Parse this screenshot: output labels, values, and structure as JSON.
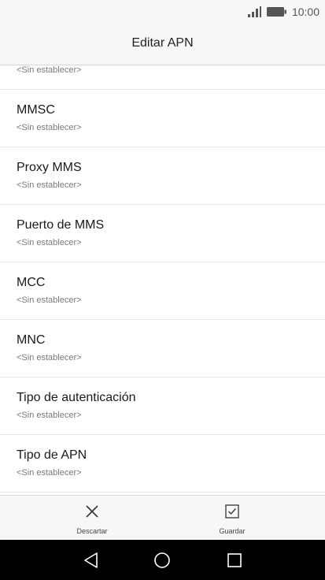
{
  "status_bar": {
    "time": "10:00",
    "icons": [
      "signal-icon",
      "battery-icon"
    ]
  },
  "header": {
    "title": "Editar APN"
  },
  "list": {
    "items": [
      {
        "title": "",
        "value": "<Sin establecer>"
      },
      {
        "title": "MMSC",
        "value": "<Sin establecer>"
      },
      {
        "title": "Proxy MMS",
        "value": "<Sin establecer>"
      },
      {
        "title": "Puerto de MMS",
        "value": "<Sin establecer>"
      },
      {
        "title": "MCC",
        "value": "<Sin establecer>"
      },
      {
        "title": "MNC",
        "value": "<Sin establecer>"
      },
      {
        "title": "Tipo de autenticación",
        "value": "<Sin establecer>"
      },
      {
        "title": "Tipo de APN",
        "value": "<Sin establecer>"
      }
    ]
  },
  "bottom_bar": {
    "discard_label": "Descartar",
    "save_label": "Guardar",
    "discard_icon": "close-icon",
    "save_icon": "checkbox-icon"
  },
  "nav_bar": {
    "icons": [
      "back-icon",
      "home-icon",
      "recents-icon"
    ]
  }
}
